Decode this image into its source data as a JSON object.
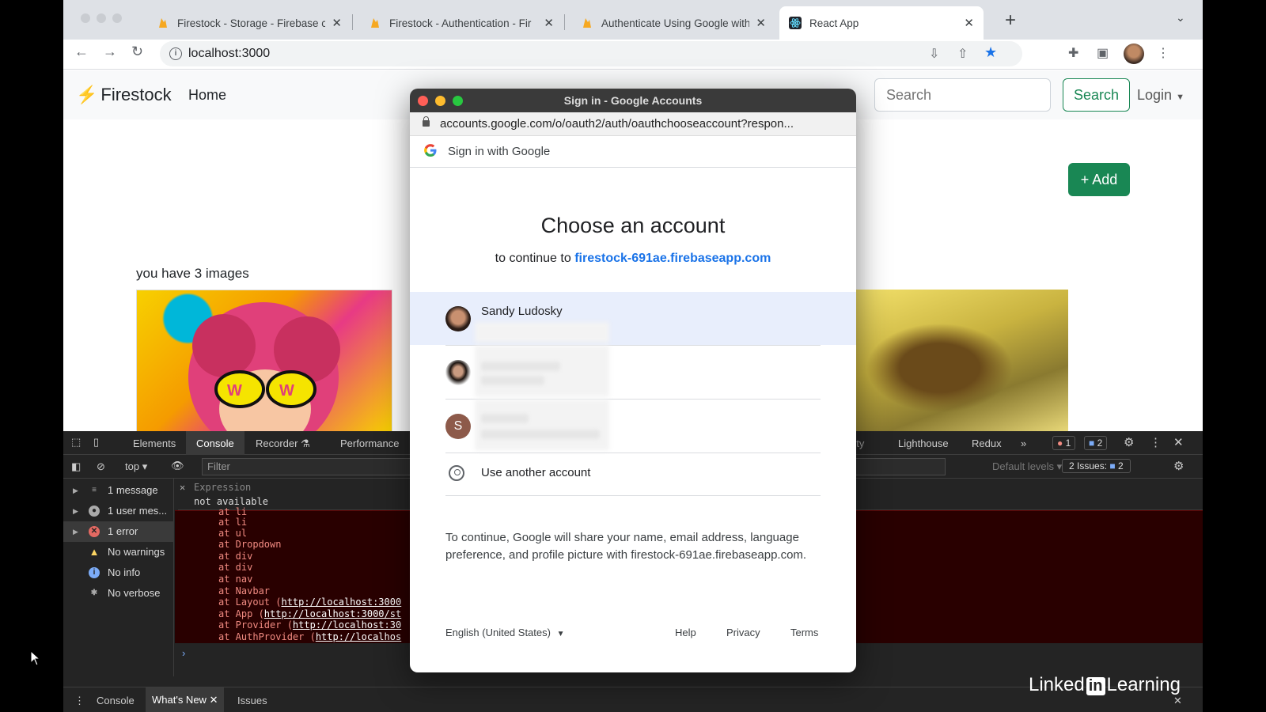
{
  "browser": {
    "tabs": [
      {
        "title": "Firestock - Storage - Firebase c"
      },
      {
        "title": "Firestock - Authentication - Fir"
      },
      {
        "title": "Authenticate Using Google with"
      },
      {
        "title": "React App"
      }
    ],
    "url": "localhost:3000"
  },
  "app": {
    "brand": "Firestock",
    "nav_home": "Home",
    "search_placeholder": "Search",
    "search_button": "Search",
    "login": "Login",
    "add_button": "+ Add",
    "image_count_text": "you have 3 images"
  },
  "popup": {
    "window_title": "Sign in - Google Accounts",
    "url": "accounts.google.com/o/oauth2/auth/oauthchooseaccount?respon...",
    "header": "Sign in with Google",
    "heading": "Choose an account",
    "continue_prefix": "to continue to",
    "continue_domain": "firestock-691ae.firebaseapp.com",
    "accounts": [
      {
        "name": "Sandy Ludosky",
        "initial": ""
      },
      {
        "name": "",
        "initial": ""
      },
      {
        "name": "",
        "initial": "S"
      }
    ],
    "use_another": "Use another account",
    "disclaimer": "To continue, Google will share your name, email address, language preference, and profile picture with firestock-691ae.firebaseapp.com.",
    "language": "English (United States)",
    "footer": {
      "help": "Help",
      "privacy": "Privacy",
      "terms": "Terms"
    }
  },
  "devtools": {
    "tabs": {
      "elements": "Elements",
      "console": "Console",
      "recorder": "Recorder",
      "performance": "Performance",
      "security_partial": "rity",
      "lighthouse": "Lighthouse",
      "redux": "Redux"
    },
    "error_badge": "1",
    "message_badge": "2",
    "context": "top",
    "filter_placeholder": "Filter",
    "default_levels": "Default levels",
    "issues": "2 Issues:",
    "issues_count": "2",
    "sidebar": [
      {
        "label": "1 message"
      },
      {
        "label": "1 user mes..."
      },
      {
        "label": "1 error"
      },
      {
        "label": "No warnings"
      },
      {
        "label": "No info"
      },
      {
        "label": "No verbose"
      }
    ],
    "expression_label": "Expression",
    "expression_value": "not available",
    "stack": [
      {
        "text": "at li",
        "link": ""
      },
      {
        "text": "at ul",
        "link": ""
      },
      {
        "text": "at Dropdown",
        "link": ""
      },
      {
        "text": "at div",
        "link": ""
      },
      {
        "text": "at div",
        "link": ""
      },
      {
        "text": "at nav",
        "link": ""
      },
      {
        "text": "at Navbar",
        "link": ""
      },
      {
        "text": "at Layout (",
        "link": "http://localhost:3000"
      },
      {
        "text": "at App (",
        "link": "http://localhost:3000/st"
      },
      {
        "text": "at Provider (",
        "link": "http://localhost:30"
      },
      {
        "text": "at AuthProvider (",
        "link": "http://localhos"
      }
    ],
    "drawer": {
      "console": "Console",
      "whats_new": "What's New",
      "issues": "Issues"
    }
  },
  "watermark": {
    "left": "Linked",
    "in": "in",
    "right": "Learning"
  }
}
